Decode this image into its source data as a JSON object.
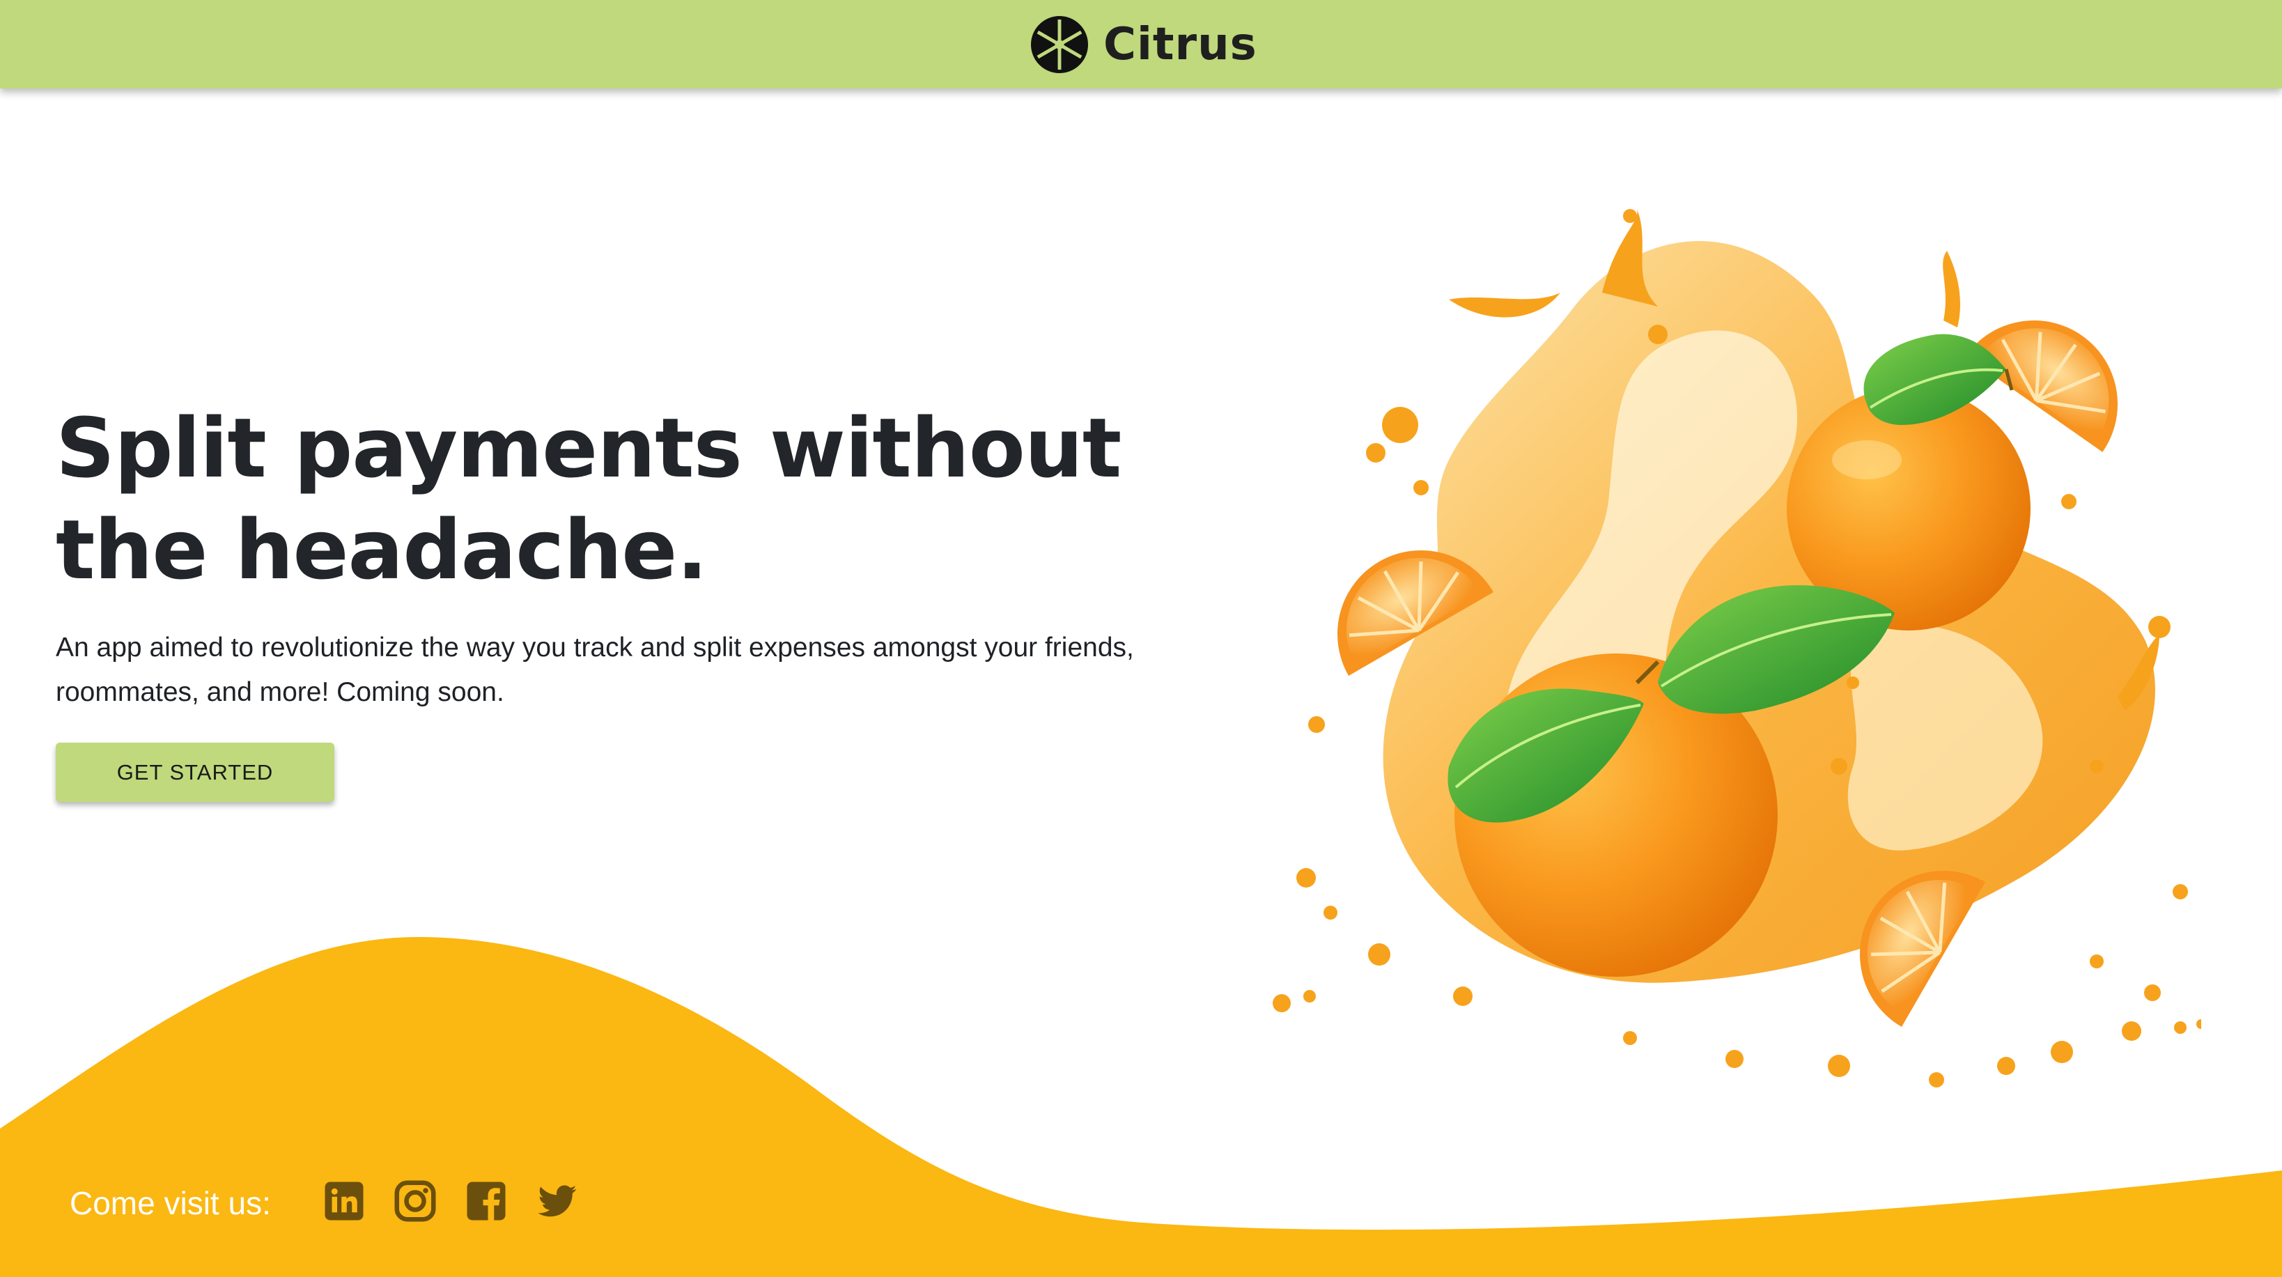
{
  "header": {
    "brand_name": "Citrus"
  },
  "hero": {
    "headline": "Split payments without the headache.",
    "subtitle": "An app aimed to revolutionize the way you track and split expenses amongst your friends, roommates, and more! Coming soon.",
    "cta_label": "GET STARTED"
  },
  "footer": {
    "visit_label": "Come visit us:",
    "social_icons": [
      "linkedin-icon",
      "instagram-icon",
      "facebook-icon",
      "twitter-icon"
    ]
  },
  "colors": {
    "header_bg": "#bfd97c",
    "accent_yellow": "#fbb712",
    "text_dark": "#22252a",
    "social_icon": "#6b4f0c",
    "orange": "#f7931e"
  }
}
